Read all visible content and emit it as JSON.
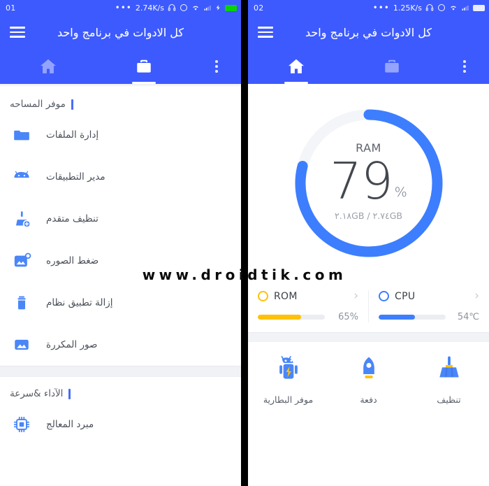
{
  "watermark": "www.droidtik.com",
  "left": {
    "statusbar": {
      "clock": "01",
      "dots": "•••",
      "speed": "2.74K/s",
      "icons": [
        "headset-icon",
        "circle-icon",
        "wifi-icon",
        "signal-icon",
        "charging-icon",
        "battery-icon"
      ]
    },
    "appbar": {
      "menu_icon": "hamburger-icon",
      "title": "كل الادوات في برنامج واحد",
      "tabs": [
        {
          "name": "home",
          "icon": "home-icon",
          "active": false
        },
        {
          "name": "toolbox",
          "icon": "briefcase-icon",
          "active": true
        }
      ],
      "more_icon": "kebab-menu-icon"
    },
    "sections": [
      {
        "title": "موفر المساحه",
        "items": [
          {
            "label": "إدارة الملفات",
            "icon": "folder-icon"
          },
          {
            "label": "مدير التطبيقات",
            "icon": "android-robot-icon"
          },
          {
            "label": "تنظيف متقدم",
            "icon": "broom-plus-icon"
          },
          {
            "label": "ضغط الصوره",
            "icon": "image-compress-icon"
          },
          {
            "label": "إزالة تطبيق نظام",
            "icon": "trash-icon"
          },
          {
            "label": "صور المكررة",
            "icon": "duplicate-photos-icon"
          }
        ]
      },
      {
        "title": "الآداء &سرعة",
        "items": [
          {
            "label": "مبرد المعالج",
            "icon": "cpu-cooler-icon"
          }
        ]
      }
    ]
  },
  "right": {
    "statusbar": {
      "clock": "02",
      "dots": "•••",
      "speed": "1.25K/s",
      "icons": [
        "headset-icon",
        "circle-icon",
        "wifi-icon",
        "signal-icon",
        "battery-icon"
      ]
    },
    "appbar": {
      "menu_icon": "hamburger-icon",
      "title": "كل الادوات في برنامج واحد",
      "tabs": [
        {
          "name": "home",
          "icon": "home-icon",
          "active": true
        },
        {
          "name": "toolbox",
          "icon": "briefcase-icon",
          "active": false
        }
      ],
      "more_icon": "kebab-menu-icon"
    },
    "ram": {
      "label": "RAM",
      "value": "79",
      "unit": "%",
      "percent": 79,
      "detail": "٢.١٨GB / ٢.٧٤GB",
      "ring_color": "#3d7eff",
      "track_color": "#f4f5f8"
    },
    "stats": [
      {
        "name": "ROM",
        "value": "65%",
        "percent": 65,
        "color": "#ffc107",
        "chevron": "chevron-right-icon"
      },
      {
        "name": "CPU",
        "value": "54℃",
        "percent": 54,
        "color": "#3d7eff",
        "chevron": "chevron-right-icon"
      }
    ],
    "actions": [
      {
        "label": "تنظيف",
        "icon": "broom-icon"
      },
      {
        "label": "دفعة",
        "icon": "rocket-icon"
      },
      {
        "label": "موفر البطارية",
        "icon": "battery-saver-robot-icon"
      }
    ]
  }
}
